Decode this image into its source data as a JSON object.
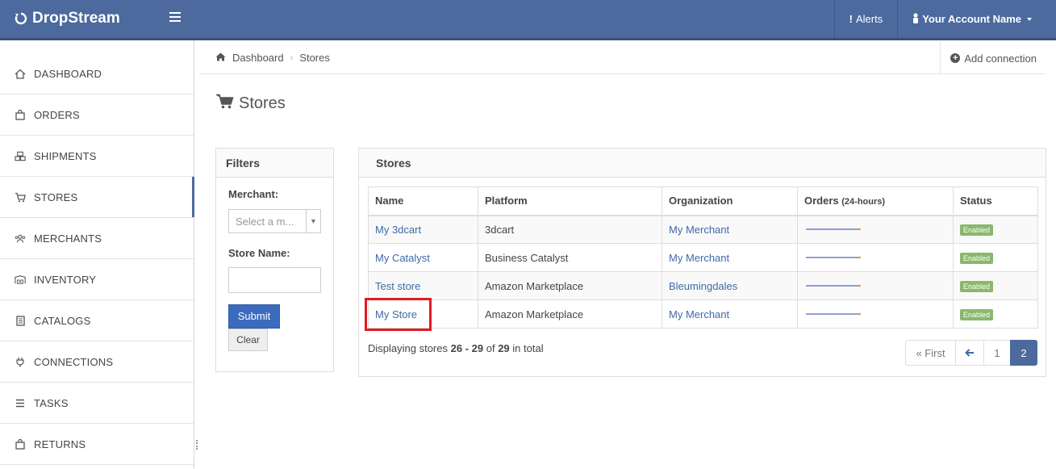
{
  "brand": {
    "name": "DropStream"
  },
  "topnav": {
    "alerts_label": "Alerts",
    "account_label": "Your Account Name"
  },
  "sidebar": {
    "items": [
      {
        "label": "DASHBOARD",
        "icon": "home-icon"
      },
      {
        "label": "ORDERS",
        "icon": "bag-icon"
      },
      {
        "label": "SHIPMENTS",
        "icon": "cubes-icon"
      },
      {
        "label": "STORES",
        "icon": "cart-icon",
        "active": true
      },
      {
        "label": "MERCHANTS",
        "icon": "users-icon"
      },
      {
        "label": "INVENTORY",
        "icon": "warehouse-icon"
      },
      {
        "label": "CATALOGS",
        "icon": "book-icon"
      },
      {
        "label": "CONNECTIONS",
        "icon": "plug-icon"
      },
      {
        "label": "TASKS",
        "icon": "list-icon"
      },
      {
        "label": "RETURNS",
        "icon": "bag-icon"
      }
    ]
  },
  "breadcrumb": {
    "home": "Dashboard",
    "current": "Stores"
  },
  "actions": {
    "add_connection": "Add connection"
  },
  "page": {
    "title": "Stores"
  },
  "filters": {
    "title": "Filters",
    "merchant_label": "Merchant:",
    "merchant_placeholder": "Select a m...",
    "store_name_label": "Store Name:",
    "store_name_value": "",
    "submit_label": "Submit",
    "clear_label": "Clear"
  },
  "stores": {
    "title": "Stores",
    "columns": {
      "name": "Name",
      "platform": "Platform",
      "organization": "Organization",
      "orders": "Orders",
      "orders_sub": "(24-hours)",
      "status": "Status"
    },
    "rows": [
      {
        "name": "My 3dcart",
        "platform": "3dcart",
        "organization": "My Merchant",
        "status": "Enabled"
      },
      {
        "name": "My Catalyst",
        "platform": "Business Catalyst",
        "organization": "My Merchant",
        "status": "Enabled"
      },
      {
        "name": "Test store",
        "platform": "Amazon Marketplace",
        "organization": "Bleumingdales",
        "status": "Enabled"
      },
      {
        "name": "My Store",
        "platform": "Amazon Marketplace",
        "organization": "My Merchant",
        "status": "Enabled"
      }
    ],
    "footer": {
      "prefix": "Displaying stores",
      "range": "26 - 29",
      "of": "of",
      "total": "29",
      "suffix": "in total"
    }
  },
  "pagination": {
    "first": "« First",
    "prev_icon": "arrow-left-icon",
    "pages": [
      "1",
      "2"
    ],
    "current": "2"
  },
  "colors": {
    "navbar": "#4c6a9e",
    "link": "#3f6aa8",
    "badge": "#8ab86c",
    "highlight": "#e01b24",
    "submit": "#3a6bbd"
  }
}
